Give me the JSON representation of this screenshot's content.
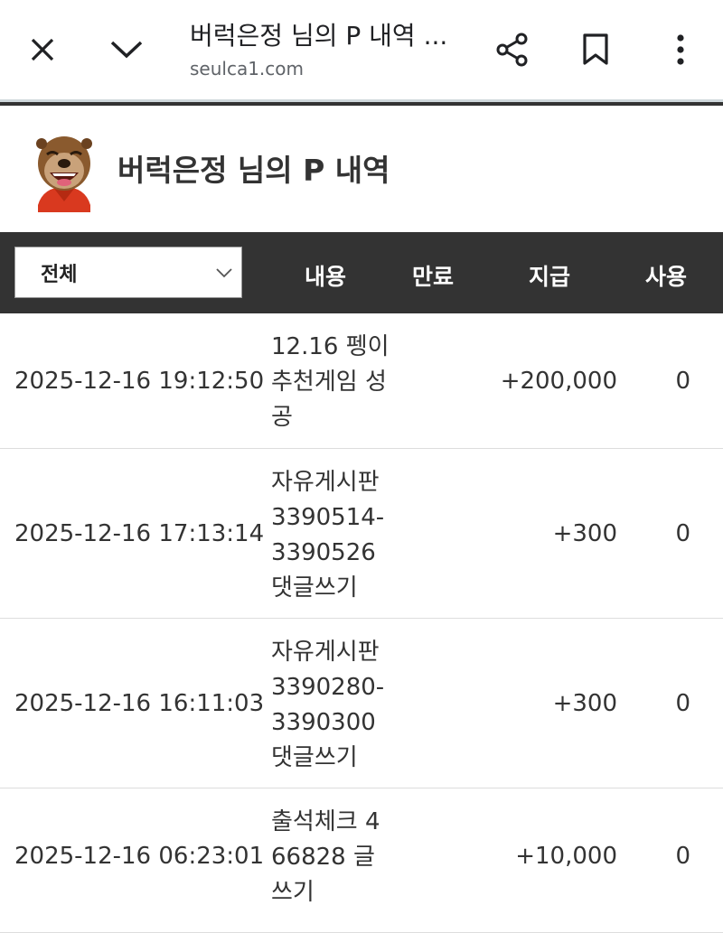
{
  "browser": {
    "title": "버럭은정 님의 P 내역 ...",
    "url": "seulca1.com"
  },
  "profile": {
    "title": "버럭은정 님의 P 내역"
  },
  "table": {
    "filter_value": "전체",
    "columns": {
      "content": "내용",
      "expire": "만료",
      "give": "지급",
      "use": "사용"
    },
    "rows": [
      {
        "date": "2025-12-16 19:12:50",
        "content": "12.16 펭이 추천게임 성공",
        "expire": "",
        "give": "+200,000",
        "use": "0"
      },
      {
        "date": "2025-12-16 17:13:14",
        "content": "자유게시판 3390514-3390526 댓글쓰기",
        "expire": "",
        "give": "+300",
        "use": "0"
      },
      {
        "date": "2025-12-16 16:11:03",
        "content": "자유게시판 3390280-3390300 댓글쓰기",
        "expire": "",
        "give": "+300",
        "use": "0"
      },
      {
        "date": "2025-12-16 06:23:01",
        "content": "출석체크 466828 글쓰기",
        "expire": "",
        "give": "+10,000",
        "use": "0"
      }
    ]
  },
  "colors": {
    "header_bar": "#333333",
    "accent_line": "#cfd8dc"
  }
}
